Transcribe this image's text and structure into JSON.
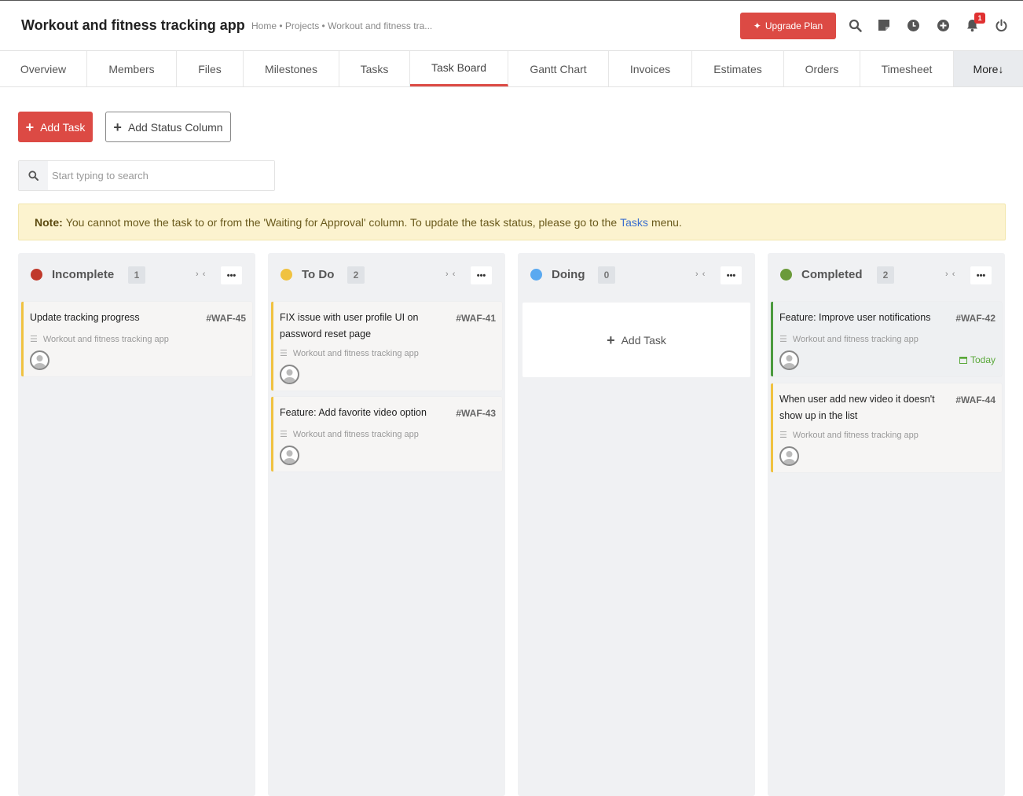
{
  "header": {
    "title": "Workout and fitness tracking app",
    "breadcrumb": "Home • Projects • Workout and fitness tra...",
    "upgrade_label": "Upgrade Plan",
    "notification_count": "1",
    "icons": [
      "search-icon",
      "sticky-note-icon",
      "clock-icon",
      "plus-circle-icon",
      "bell-icon",
      "power-icon"
    ]
  },
  "tabs": [
    {
      "label": "Overview"
    },
    {
      "label": "Members"
    },
    {
      "label": "Files"
    },
    {
      "label": "Milestones"
    },
    {
      "label": "Tasks"
    },
    {
      "label": "Task Board"
    },
    {
      "label": "Gantt Chart"
    },
    {
      "label": "Invoices"
    },
    {
      "label": "Estimates"
    },
    {
      "label": "Orders"
    },
    {
      "label": "Timesheet"
    },
    {
      "label": "More↓"
    }
  ],
  "active_tab": "Task Board",
  "toolbar": {
    "add_task_label": "Add Task",
    "add_status_column_label": "Add Status Column"
  },
  "search": {
    "placeholder": "Start typing to search",
    "value": ""
  },
  "note": {
    "label": "Note:",
    "text_before": "You cannot move the task to or from the 'Waiting for Approval' column. To update the task status, please go to the",
    "link": "Tasks",
    "text_after": "menu."
  },
  "colors": {
    "accent": "#dc4a44",
    "incomplete": "#c0392b",
    "todo": "#f0c240",
    "doing": "#5aa9f0",
    "completed": "#6b9a3a"
  },
  "columns": [
    {
      "title": "Incomplete",
      "count": "1",
      "collapse_glyph": "› ‹",
      "menu_glyph": "•••",
      "cards": [
        {
          "title": "Update tracking progress",
          "id": "#WAF-45",
          "project": "Workout and fitness tracking app"
        }
      ]
    },
    {
      "title": "To Do",
      "count": "2",
      "collapse_glyph": "› ‹",
      "menu_glyph": "•••",
      "cards": [
        {
          "title": "FIX issue with user profile UI on password reset page",
          "id": "#WAF-41",
          "project": "Workout and fitness tracking app"
        },
        {
          "title": "Feature: Add favorite video option",
          "id": "#WAF-43",
          "project": "Workout and fitness tracking app"
        }
      ]
    },
    {
      "title": "Doing",
      "count": "0",
      "collapse_glyph": "› ‹",
      "menu_glyph": "•••",
      "add_task_label": "Add Task",
      "cards": []
    },
    {
      "title": "Completed",
      "count": "2",
      "collapse_glyph": "› ‹",
      "menu_glyph": "•••",
      "cards": [
        {
          "title": "Feature: Improve user notifications",
          "id": "#WAF-42",
          "project": "Workout and fitness tracking app",
          "due": "Today"
        },
        {
          "title": "When user add new video it doesn't show up in the list",
          "id": "#WAF-44",
          "project": "Workout and fitness tracking app"
        }
      ]
    }
  ]
}
